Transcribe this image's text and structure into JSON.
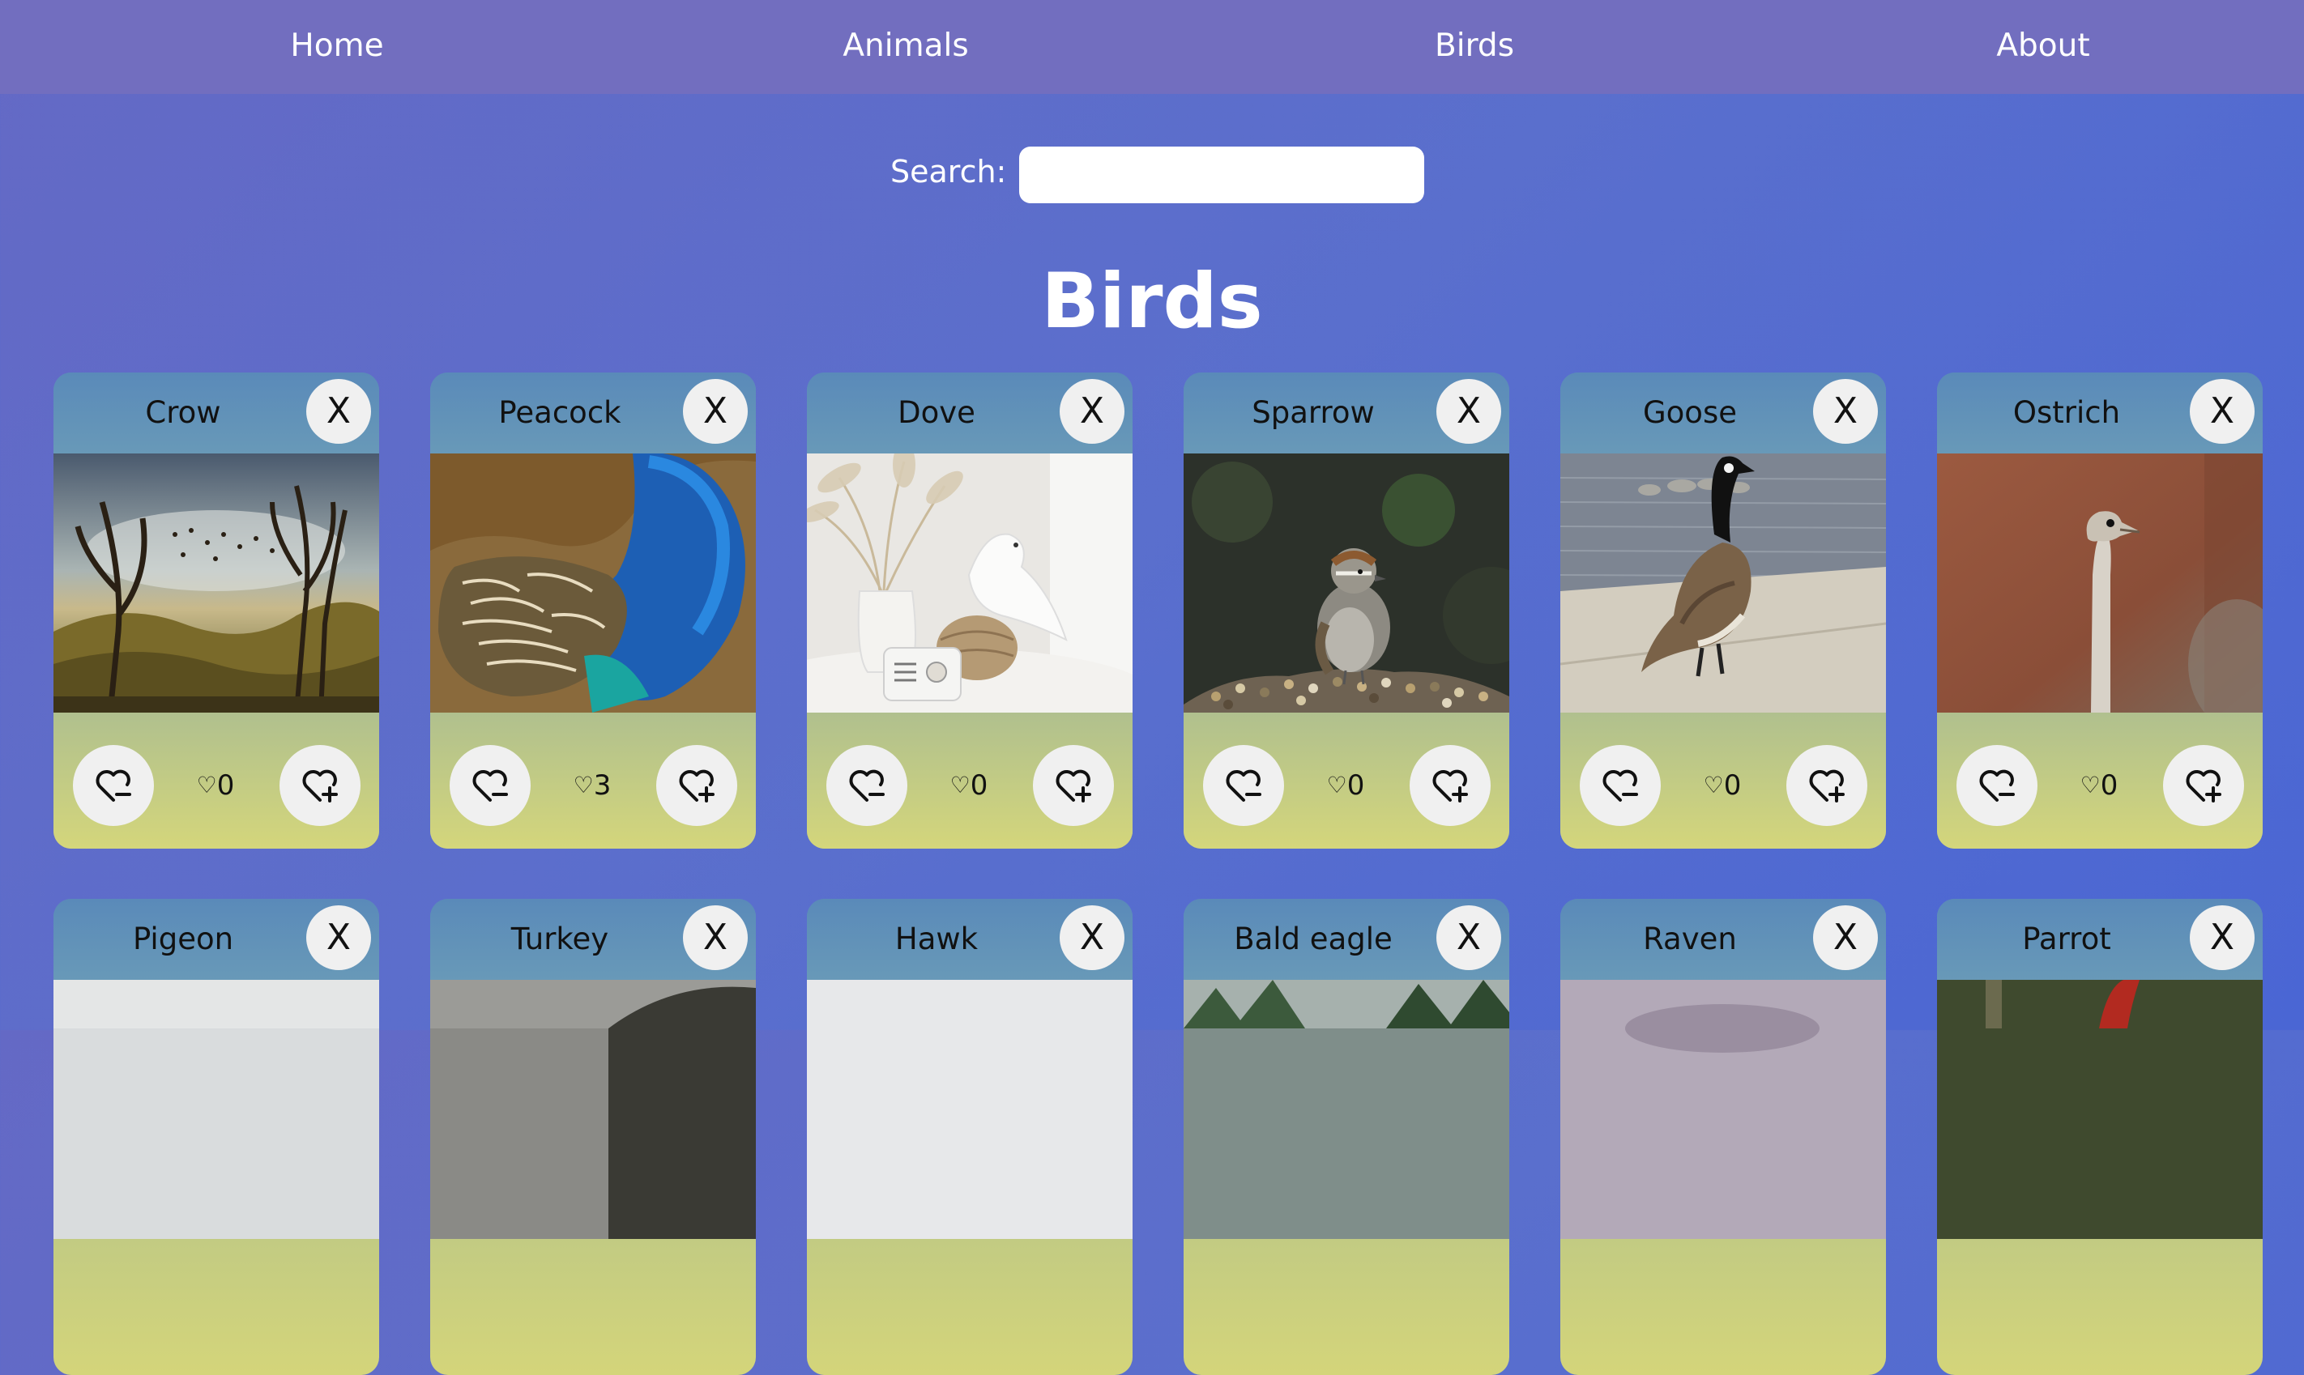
{
  "nav": {
    "items": [
      {
        "label": "Home"
      },
      {
        "label": "Animals"
      },
      {
        "label": "Birds"
      },
      {
        "label": "About"
      }
    ]
  },
  "search": {
    "label": "Search:",
    "value": "",
    "placeholder": ""
  },
  "page": {
    "title": "Birds"
  },
  "close_label": "X",
  "cards": [
    {
      "name": "Crow",
      "likes": "0",
      "image": "crow-painting"
    },
    {
      "name": "Peacock",
      "likes": "3",
      "image": "peacock-feathers"
    },
    {
      "name": "Dove",
      "likes": "0",
      "image": "dove-with-vase"
    },
    {
      "name": "Sparrow",
      "likes": "0",
      "image": "sparrow-on-seeds"
    },
    {
      "name": "Goose",
      "likes": "0",
      "image": "goose-by-water"
    },
    {
      "name": "Ostrich",
      "likes": "0",
      "image": "ostrich-head"
    },
    {
      "name": "Pigeon",
      "image": "pigeon"
    },
    {
      "name": "Turkey",
      "image": "turkey"
    },
    {
      "name": "Hawk",
      "image": "hawk"
    },
    {
      "name": "Bald eagle",
      "image": "bald-eagle"
    },
    {
      "name": "Raven",
      "image": "raven"
    },
    {
      "name": "Parrot",
      "image": "parrot"
    }
  ],
  "icons": {
    "close": "close-icon",
    "unlike": "heart-minus-icon",
    "like": "heart-plus-icon",
    "count": "heart-outline-icon"
  },
  "colors": {
    "navbar": "#726ebf",
    "background": "#5a6fcd",
    "card_header": "#5a8ab9",
    "card_footer": "#d4d67b",
    "button": "#f0f0f0"
  }
}
